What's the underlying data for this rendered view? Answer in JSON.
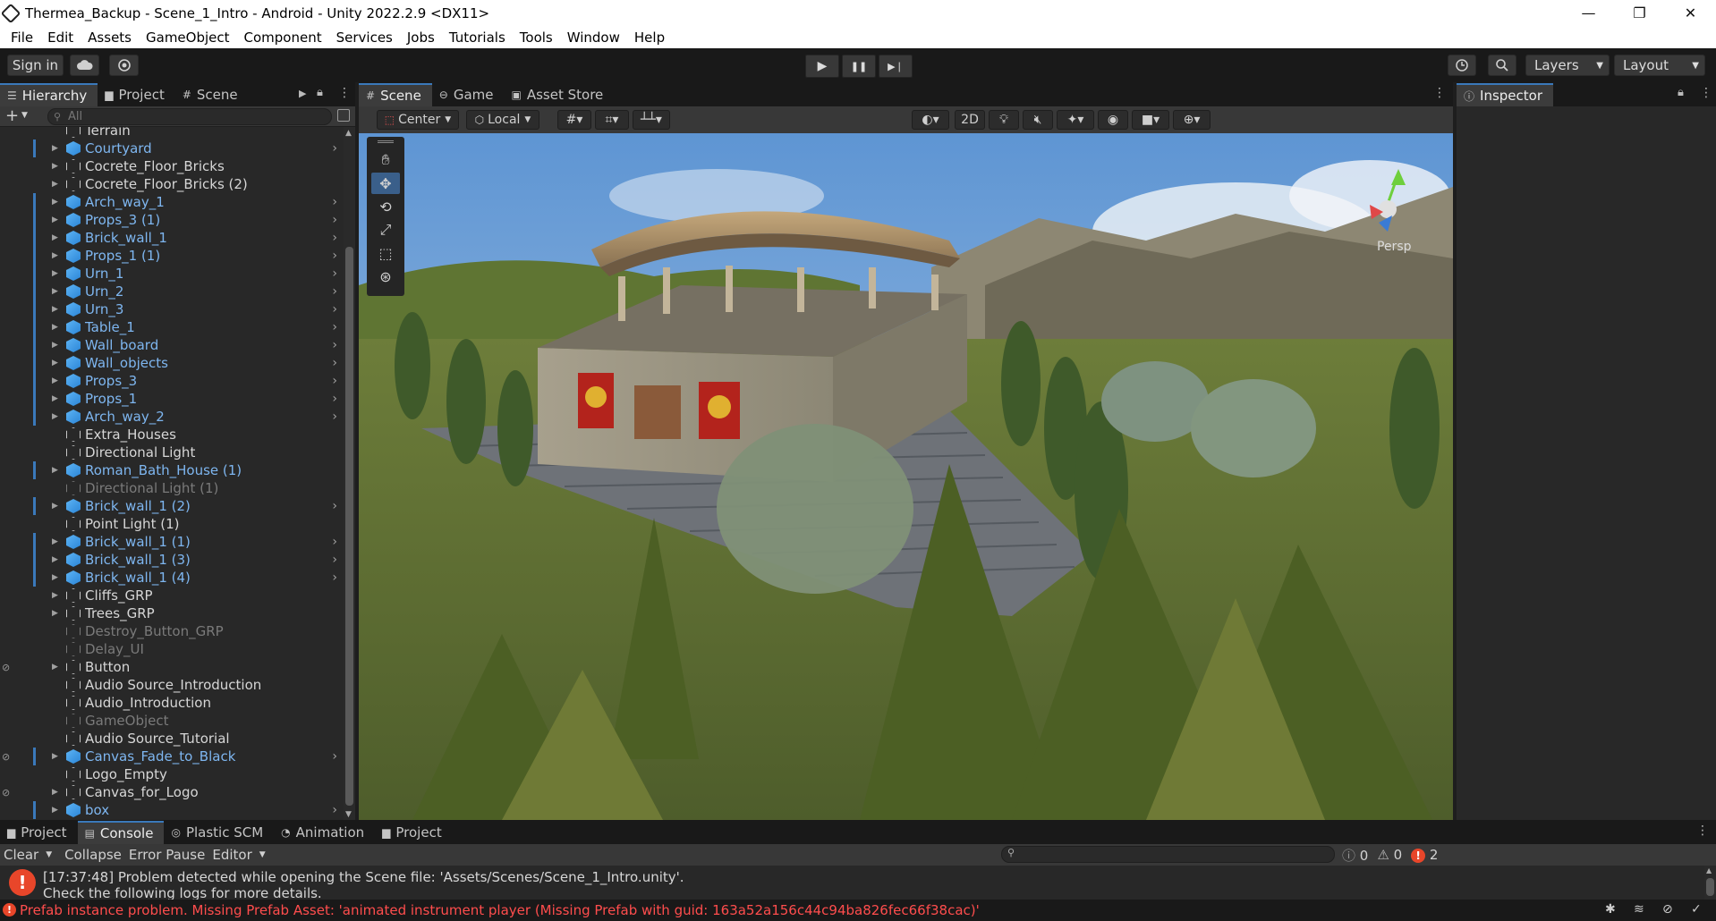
{
  "window": {
    "title": "Thermea_Backup - Scene_1_Intro - Android - Unity 2022.2.9 <DX11>",
    "minimize": "—",
    "maximize": "❐",
    "close": "✕"
  },
  "menu": [
    "File",
    "Edit",
    "Assets",
    "GameObject",
    "Component",
    "Services",
    "Jobs",
    "Tutorials",
    "Tools",
    "Window",
    "Help"
  ],
  "toolbar": {
    "sign_in": "Sign in",
    "cloud_icon": "cloud-icon",
    "collab_icon": "collab-icon",
    "play": "▶",
    "pause": "❚❚",
    "step": "▶❘",
    "history_icon": "history-icon",
    "search_icon": "search-icon",
    "layers": "Layers",
    "layout": "Layout"
  },
  "left_tabs": [
    "Hierarchy",
    "Project",
    "Scene"
  ],
  "hierarchy": {
    "add": "+",
    "search_placeholder": "All",
    "rows": [
      {
        "name": "Terrain",
        "type": "normal",
        "fold": false,
        "chev": false,
        "bar": false,
        "vis": false
      },
      {
        "name": "Courtyard",
        "type": "prefab",
        "fold": true,
        "chev": true,
        "bar": true,
        "vis": false
      },
      {
        "name": "Cocrete_Floor_Bricks",
        "type": "normal",
        "fold": true,
        "chev": false,
        "bar": false,
        "vis": false
      },
      {
        "name": "Cocrete_Floor_Bricks (2)",
        "type": "normal",
        "fold": true,
        "chev": false,
        "bar": false,
        "vis": false
      },
      {
        "name": "Arch_way_1",
        "type": "prefab",
        "fold": true,
        "chev": true,
        "bar": true,
        "vis": false
      },
      {
        "name": "Props_3 (1)",
        "type": "prefab",
        "fold": true,
        "chev": true,
        "bar": true,
        "vis": false
      },
      {
        "name": "Brick_wall_1",
        "type": "prefab",
        "fold": true,
        "chev": true,
        "bar": true,
        "vis": false
      },
      {
        "name": "Props_1 (1)",
        "type": "prefab",
        "fold": true,
        "chev": true,
        "bar": true,
        "vis": false
      },
      {
        "name": "Urn_1",
        "type": "prefab",
        "fold": true,
        "chev": true,
        "bar": true,
        "vis": false
      },
      {
        "name": "Urn_2",
        "type": "prefab",
        "fold": true,
        "chev": true,
        "bar": true,
        "vis": false
      },
      {
        "name": "Urn_3",
        "type": "prefab",
        "fold": true,
        "chev": true,
        "bar": true,
        "vis": false
      },
      {
        "name": "Table_1",
        "type": "prefab",
        "fold": true,
        "chev": true,
        "bar": true,
        "vis": false
      },
      {
        "name": "Wall_board",
        "type": "prefab",
        "fold": true,
        "chev": true,
        "bar": true,
        "vis": false
      },
      {
        "name": "Wall_objects",
        "type": "prefab",
        "fold": true,
        "chev": true,
        "bar": true,
        "vis": false
      },
      {
        "name": "Props_3",
        "type": "prefab",
        "fold": true,
        "chev": true,
        "bar": true,
        "vis": false
      },
      {
        "name": "Props_1",
        "type": "prefab",
        "fold": true,
        "chev": true,
        "bar": true,
        "vis": false
      },
      {
        "name": "Arch_way_2",
        "type": "prefab",
        "fold": true,
        "chev": true,
        "bar": true,
        "vis": false
      },
      {
        "name": "Extra_Houses",
        "type": "normal",
        "fold": false,
        "chev": false,
        "bar": false,
        "vis": false
      },
      {
        "name": "Directional Light",
        "type": "normal",
        "fold": false,
        "chev": false,
        "bar": false,
        "vis": false
      },
      {
        "name": "Roman_Bath_House (1)",
        "type": "prefab",
        "fold": true,
        "chev": false,
        "bar": true,
        "vis": false
      },
      {
        "name": "Directional Light (1)",
        "type": "inactive",
        "fold": false,
        "chev": false,
        "bar": false,
        "vis": false
      },
      {
        "name": "Brick_wall_1 (2)",
        "type": "prefab",
        "fold": true,
        "chev": true,
        "bar": true,
        "vis": false
      },
      {
        "name": "Point Light (1)",
        "type": "normal",
        "fold": false,
        "chev": false,
        "bar": false,
        "vis": false
      },
      {
        "name": "Brick_wall_1 (1)",
        "type": "prefab",
        "fold": true,
        "chev": true,
        "bar": true,
        "vis": false
      },
      {
        "name": "Brick_wall_1 (3)",
        "type": "prefab",
        "fold": true,
        "chev": true,
        "bar": true,
        "vis": false
      },
      {
        "name": "Brick_wall_1 (4)",
        "type": "prefab",
        "fold": true,
        "chev": true,
        "bar": true,
        "vis": false
      },
      {
        "name": "Cliffs_GRP",
        "type": "normal",
        "fold": true,
        "chev": false,
        "bar": false,
        "vis": false
      },
      {
        "name": "Trees_GRP",
        "type": "normal",
        "fold": true,
        "chev": false,
        "bar": false,
        "vis": false
      },
      {
        "name": "Destroy_Button_GRP",
        "type": "inactive",
        "fold": false,
        "chev": false,
        "bar": false,
        "vis": false
      },
      {
        "name": "Delay_UI",
        "type": "inactive",
        "fold": false,
        "chev": false,
        "bar": false,
        "vis": false
      },
      {
        "name": "Button",
        "type": "normal",
        "fold": true,
        "chev": false,
        "bar": false,
        "vis": true
      },
      {
        "name": "Audio Source_Introduction",
        "type": "normal",
        "fold": false,
        "chev": false,
        "bar": false,
        "vis": false
      },
      {
        "name": "Audio_Introduction",
        "type": "normal",
        "fold": false,
        "chev": false,
        "bar": false,
        "vis": false
      },
      {
        "name": "GameObject",
        "type": "inactive",
        "fold": false,
        "chev": false,
        "bar": false,
        "vis": false
      },
      {
        "name": "Audio Source_Tutorial",
        "type": "normal",
        "fold": false,
        "chev": false,
        "bar": false,
        "vis": false
      },
      {
        "name": "Canvas_Fade_to_Black",
        "type": "prefab",
        "fold": true,
        "chev": true,
        "bar": true,
        "vis": true
      },
      {
        "name": "Logo_Empty",
        "type": "normal",
        "fold": false,
        "chev": false,
        "bar": false,
        "vis": false
      },
      {
        "name": "Canvas_for_Logo",
        "type": "normal",
        "fold": true,
        "chev": false,
        "bar": false,
        "vis": true
      },
      {
        "name": "box",
        "type": "prefab",
        "fold": true,
        "chev": true,
        "bar": true,
        "vis": false
      }
    ]
  },
  "scene_tabs": [
    "Scene",
    "Game",
    "Asset Store"
  ],
  "scene_toolbar": {
    "pivot": "Center",
    "space": "Local",
    "mode_2d": "2D"
  },
  "scene": {
    "persp_label": "Persp"
  },
  "inspector": {
    "tab": "Inspector"
  },
  "bottom_tabs": [
    "Project",
    "Console",
    "Plastic SCM",
    "Animation",
    "Project"
  ],
  "console": {
    "clear": "Clear",
    "collapse": "Collapse",
    "error_pause": "Error Pause",
    "editor": "Editor",
    "count_info": "0",
    "count_warn": "0",
    "count_error": "2",
    "message_line1": "[17:37:48] Problem detected while opening the Scene file: 'Assets/Scenes/Scene_1_Intro.unity'.",
    "message_line2": "Check the following logs for more details."
  },
  "status": {
    "message": "Prefab instance problem. Missing Prefab Asset: 'animated instrument player (Missing Prefab with guid: 163a52a156c44c94ba826fec66f38cac)'"
  },
  "colors": {
    "accent": "#3a79bb",
    "prefab_text": "#7eb6f0",
    "error": "#e8462a"
  }
}
